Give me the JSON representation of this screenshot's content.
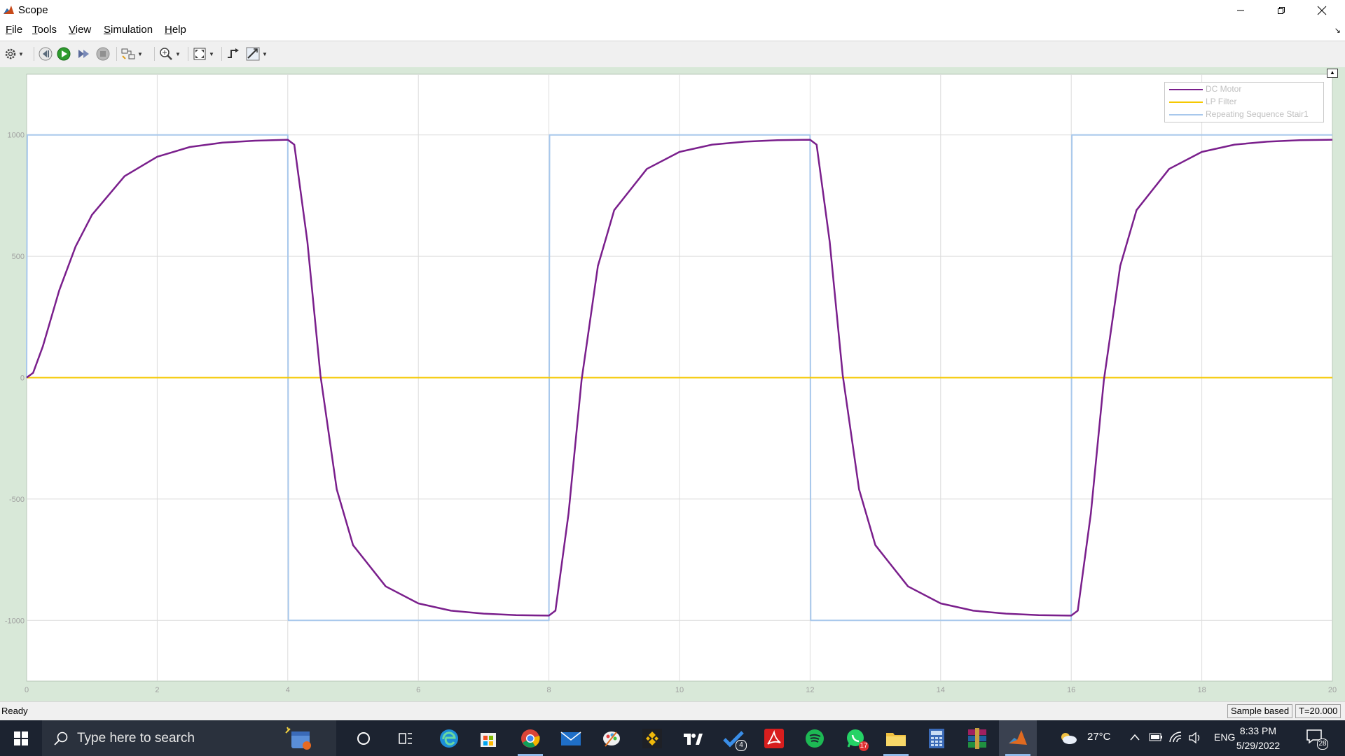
{
  "window": {
    "title": "Scope"
  },
  "menu": {
    "items": [
      "File",
      "Tools",
      "View",
      "Simulation",
      "Help"
    ]
  },
  "toolbar": {
    "icons": [
      "settings-gear-icon",
      "step-back-icon",
      "run-icon",
      "step-forward-icon",
      "stop-icon",
      "highlight-simulink-block-icon",
      "zoom-icon",
      "fit-to-view-icon",
      "triggers-icon",
      "measurements-icon"
    ]
  },
  "chart_data": {
    "type": "line",
    "xlim": [
      0,
      20
    ],
    "ylim": [
      -1250,
      1250
    ],
    "x_ticks": [
      "0",
      "2",
      "4",
      "6",
      "8",
      "10",
      "12",
      "14",
      "16",
      "18",
      "20"
    ],
    "y_ticks": [
      "1000",
      "500",
      "0",
      "-500",
      "-1000"
    ],
    "grid": true,
    "legend_position": "top-right",
    "series": [
      {
        "name": "DC Motor",
        "color": "#7a1f8c",
        "x": [
          0,
          0.1,
          0.25,
          0.5,
          0.75,
          1.0,
          1.5,
          2.0,
          2.5,
          3.0,
          3.5,
          4.0,
          4.1,
          4.3,
          4.5,
          4.75,
          5.0,
          5.5,
          6.0,
          6.5,
          7.0,
          7.5,
          8.0,
          8.1,
          8.3,
          8.5,
          8.75,
          9.0,
          9.5,
          10.0,
          10.5,
          11.0,
          11.5,
          12.0,
          12.1,
          12.3,
          12.5,
          12.75,
          13.0,
          13.5,
          14.0,
          14.5,
          15.0,
          15.5,
          16.0,
          16.1,
          16.3,
          16.5,
          16.75,
          17.0,
          17.5,
          18.0,
          18.5,
          19.0,
          19.5,
          20.0
        ],
        "y": [
          0,
          20,
          130,
          360,
          540,
          670,
          830,
          910,
          950,
          968,
          976,
          980,
          960,
          560,
          10,
          -460,
          -690,
          -860,
          -930,
          -960,
          -972,
          -978,
          -980,
          -960,
          -560,
          -10,
          460,
          690,
          860,
          930,
          960,
          972,
          978,
          980,
          960,
          560,
          10,
          -460,
          -690,
          -860,
          -930,
          -960,
          -972,
          -978,
          -980,
          -960,
          -560,
          -10,
          460,
          690,
          860,
          930,
          960,
          972,
          978,
          980
        ]
      },
      {
        "name": "LP Filter",
        "color": "#f5c800",
        "x": [
          0,
          20
        ],
        "y": [
          0,
          0
        ]
      },
      {
        "name": "Repeating Sequence Stair1",
        "color": "#a8c8ec",
        "x": [
          0,
          0.01,
          4,
          4.01,
          8,
          8.01,
          12,
          12.01,
          16,
          16.01,
          20
        ],
        "y": [
          0,
          1000,
          1000,
          -1000,
          -1000,
          1000,
          1000,
          -1000,
          -1000,
          1000,
          1000
        ]
      }
    ]
  },
  "status": {
    "left": "Ready",
    "mode": "Sample based",
    "time": "T=20.000"
  },
  "taskbar": {
    "search_placeholder": "Type here to search",
    "apps": [
      {
        "name": "weather-widget-icon"
      },
      {
        "name": "cortana-icon"
      },
      {
        "name": "task-view-icon"
      },
      {
        "name": "edge-icon"
      },
      {
        "name": "store-icon"
      },
      {
        "name": "chrome-icon"
      },
      {
        "name": "mail-icon"
      },
      {
        "name": "paint-icon"
      },
      {
        "name": "binance-icon"
      },
      {
        "name": "tradingview-icon"
      },
      {
        "name": "todo-icon",
        "badge": "4"
      },
      {
        "name": "acrobat-icon"
      },
      {
        "name": "spotify-icon"
      },
      {
        "name": "whatsapp-icon",
        "badge": "17"
      },
      {
        "name": "file-explorer-icon"
      },
      {
        "name": "calculator-icon"
      },
      {
        "name": "winrar-icon"
      },
      {
        "name": "matlab-icon"
      }
    ],
    "weather": "27°C",
    "language": "ENG",
    "time": "8:33 PM",
    "date": "5/29/2022",
    "notifications": "28"
  }
}
